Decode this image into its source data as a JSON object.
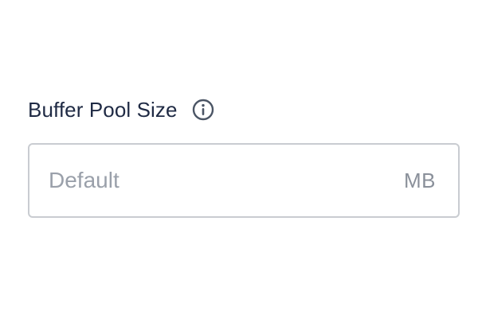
{
  "field": {
    "label": "Buffer Pool Size",
    "info_icon": "info-circle-icon",
    "input_value": "",
    "input_placeholder": "Default",
    "unit": "MB"
  },
  "colors": {
    "label": "#1f2a44",
    "placeholder": "#9aa0aa",
    "border": "#c9ccd1",
    "unit": "#8a909a",
    "icon": "#4b5565"
  }
}
